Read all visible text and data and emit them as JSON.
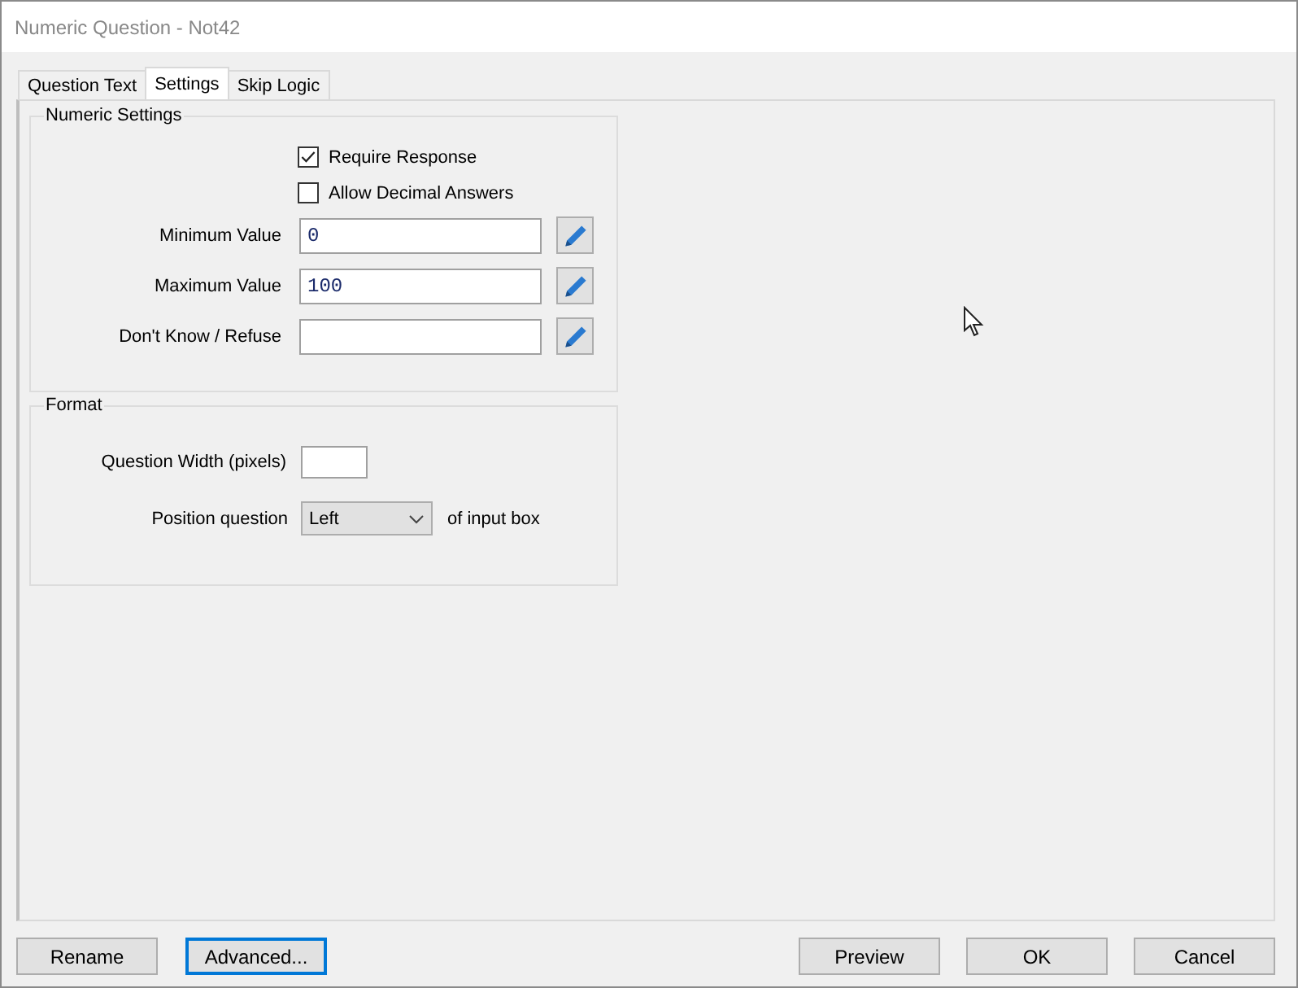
{
  "window": {
    "title": "Numeric Question - Not42"
  },
  "tabs": [
    {
      "label": "Question Text",
      "selected": false
    },
    {
      "label": "Settings",
      "selected": true
    },
    {
      "label": "Skip Logic",
      "selected": false
    }
  ],
  "numeric_settings": {
    "title": "Numeric Settings",
    "checkboxes": [
      {
        "label": "Require Response",
        "checked": true
      },
      {
        "label": "Allow Decimal Answers",
        "checked": false
      }
    ],
    "fields": [
      {
        "label": "Minimum Value",
        "value": "0"
      },
      {
        "label": "Maximum Value",
        "value": "100"
      },
      {
        "label": "Don't Know / Refuse"
      }
    ]
  },
  "format": {
    "title": "Format",
    "width_label": "Question Width (pixels)",
    "position_label": "Position question",
    "position_value": "Left",
    "position_suffix": "of input box"
  },
  "buttons_left": [
    {
      "label": "Rename",
      "focused": false
    },
    {
      "label": "Advanced...",
      "focused": true
    }
  ],
  "buttons_right": [
    {
      "label": "Preview",
      "focused": false
    },
    {
      "label": "OK",
      "focused": false
    },
    {
      "label": "Cancel",
      "focused": false
    }
  ]
}
